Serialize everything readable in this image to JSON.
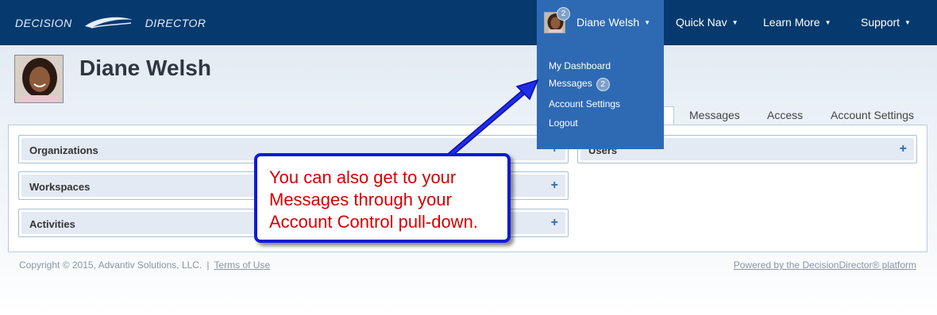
{
  "header": {
    "logo_left": "DECISION",
    "logo_right": "DIRECTOR",
    "user_name": "Diane Welsh",
    "user_badge": "2",
    "nav": [
      "Quick Nav",
      "Learn More",
      "Support"
    ]
  },
  "user_menu": {
    "items": [
      "My Dashboard",
      "Messages",
      "Account Settings",
      "Logout"
    ],
    "messages_badge": "2"
  },
  "profile": {
    "name": "Diane Welsh",
    "tabs": [
      "Messages",
      "Access",
      "Account Settings"
    ]
  },
  "sections": {
    "left": [
      "Organizations",
      "Workspaces",
      "Activities"
    ],
    "right": [
      "Users"
    ]
  },
  "callout": {
    "text": "You can also get to your Messages through your Account Control pull-down."
  },
  "footer": {
    "copyright": "Copyright © 2015, Advantiv Solutions, LLC.",
    "separator": "|",
    "terms": "Terms of Use",
    "powered": "Powered by the DecisionDirector® platform"
  },
  "colors": {
    "topbar": "#063a6e",
    "menu": "#2e6ab3",
    "callout_border": "#0d1bd6",
    "callout_text": "#d40000"
  }
}
